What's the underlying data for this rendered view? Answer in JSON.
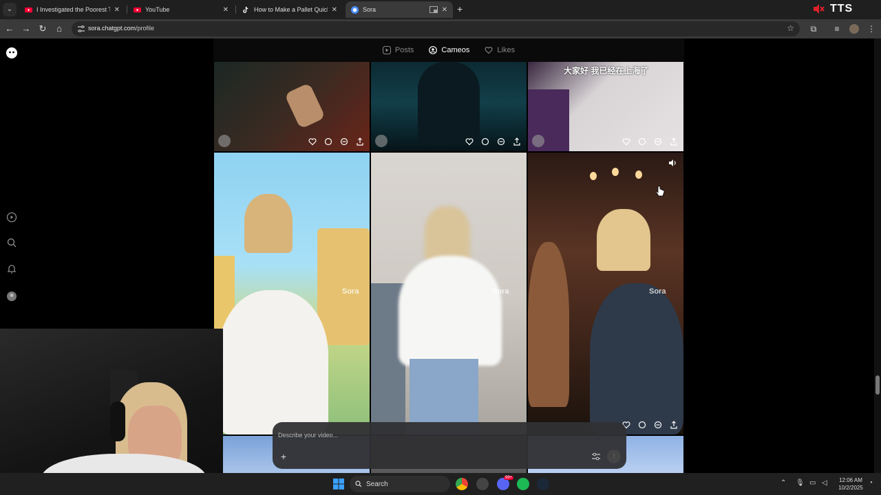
{
  "browser": {
    "tabs": [
      {
        "label": "I Investigated the Poorest Town",
        "favicon": "youtube-icon",
        "color": "#ff0033"
      },
      {
        "label": "YouTube",
        "favicon": "youtube-icon",
        "color": "#ff0033"
      },
      {
        "label": "How to Make a Pallet Quickly a",
        "favicon": "tiktok-icon",
        "color": "#ffffff"
      },
      {
        "label": "Sora",
        "favicon": "sora-icon",
        "color": "#4a8cff",
        "active": true
      }
    ],
    "new_tab": "+",
    "extension_label": "TTS",
    "url_host": "sora.chatgpt.com",
    "url_path": "/profile"
  },
  "profile_tabs": [
    {
      "label": "Posts",
      "icon": "play-square-icon"
    },
    {
      "label": "Cameos",
      "icon": "user-circle-icon",
      "active": true
    },
    {
      "label": "Likes",
      "icon": "heart-icon"
    }
  ],
  "feed": {
    "watermark": "Sora",
    "caption_top_right": "大家好 我已经在上海了"
  },
  "composer": {
    "placeholder": "Describe your video...",
    "add": "+"
  },
  "taskbar": {
    "search_label": "Search",
    "time": "12:06 AM",
    "date": "10/2/2025",
    "badge": "99+"
  },
  "colors": {
    "accent": "#4a8cff",
    "youtube": "#ff0033",
    "spotify": "#1db954"
  }
}
